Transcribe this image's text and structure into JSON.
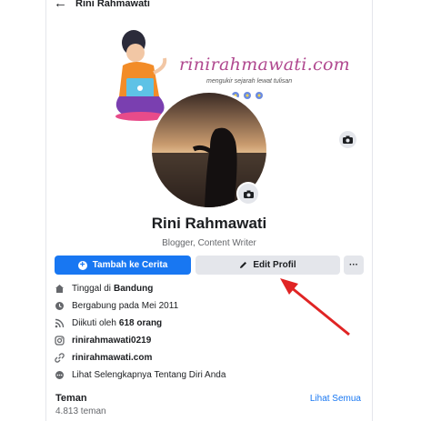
{
  "header": {
    "back_icon": "arrow-left-icon",
    "title": "Rini Rahmawati"
  },
  "cover": {
    "brand_name": "rinirahmawati.com",
    "tagline": "mengukir sejarah lewat tulisan",
    "brand_color": "#b0488f"
  },
  "profile": {
    "name": "Rini Rahmawati",
    "bio": "Blogger, Content Writer"
  },
  "actions": {
    "add_story": "Tambah ke Cerita",
    "edit_profile": "Edit Profil",
    "more": "···"
  },
  "info": {
    "hometown_prefix": "Tinggal di",
    "hometown_value": "Bandung",
    "joined": "Bergabung pada Mei 2011",
    "followers_prefix": "Diikuti oleh",
    "followers_value": "618 orang",
    "instagram": "rinirahmawati0219",
    "website": "rinirahmawati.com",
    "see_more": "Lihat Selengkapnya Tentang Diri Anda"
  },
  "friends": {
    "title": "Teman",
    "count": "4.813 teman",
    "see_all": "Lihat Semua"
  },
  "colors": {
    "primary": "#1877f2",
    "annotation_arrow": "#e02424"
  }
}
